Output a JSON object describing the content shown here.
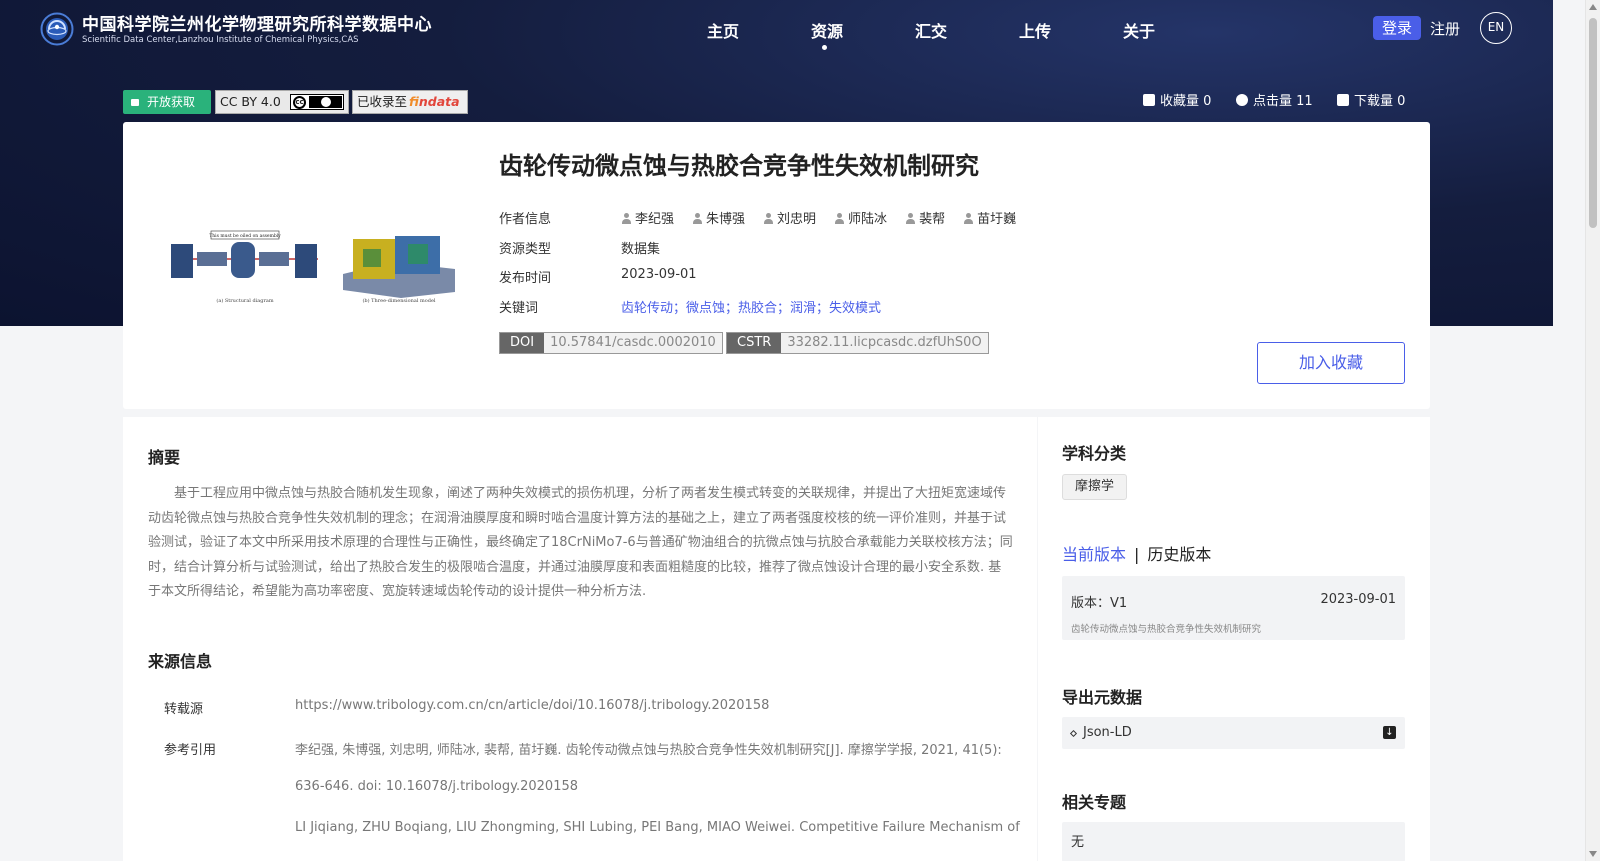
{
  "header": {
    "brand_cn": "中国科学院兰州化学物理研究所科学数据中心",
    "brand_en": "Scientific Data Center,Lanzhou Institute of Chemical Physics,CAS",
    "nav": [
      "主页",
      "资源",
      "汇交",
      "上传",
      "关于"
    ],
    "active_nav": "资源",
    "login": "登录",
    "register": "注册",
    "lang": "EN",
    "accent": "#4a5ee8"
  },
  "badges": {
    "open_access": "开放获取",
    "license": "CC BY 4.0",
    "indexed_prefix": "已收录至",
    "findata": {
      "f": "f",
      "i": "i",
      "rest": "ndata"
    }
  },
  "stats": {
    "favorites": "收藏量 0",
    "clicks": "点击量 11",
    "downloads": "下载量 0"
  },
  "record": {
    "title": "齿轮传动微点蚀与热胶合竞争性失效机制研究",
    "labels": {
      "authors": "作者信息",
      "type": "资源类型",
      "date": "发布时间",
      "keywords": "关键词"
    },
    "authors": [
      "李纪强",
      "朱博强",
      "刘忠明",
      "师陆冰",
      "裴帮",
      "苗圩巍"
    ],
    "type": "数据集",
    "date": "2023-09-01",
    "keywords": "齿轮传动；微点蚀；热胶合；润滑；失效模式",
    "doi_label": "DOI",
    "doi": "10.57841/casdc.0002010",
    "cstr_label": "CSTR",
    "cstr": "33282.11.licpcasdc.dzfUhS0O",
    "favorite_button": "加入收藏",
    "figure_captions": {
      "left_note": "This must be oiled on assembly",
      "left_caption": "(a) Structural diagram",
      "right_caption": "(b) Three-dimensional model"
    }
  },
  "abstract": {
    "title": "摘要",
    "text": "基于工程应用中微点蚀与热胶合随机发生现象，阐述了两种失效模式的损伤机理，分析了两者发生模式转变的关联规律，并提出了大扭矩宽速域传动齿轮微点蚀与热胶合竞争性失效机制的理念；在润滑油膜厚度和瞬时啮合温度计算方法的基础之上，建立了两者强度校核的统一评价准则，并基于试验测试，验证了本文中所采用技术原理的合理性与正确性，最终确定了18CrNiMo7-6与普通矿物油组合的抗微点蚀与抗胶合承载能力关联校核方法；同时，结合计算分析与试验测试，给出了热胶合发生的极限啮合温度，并通过油膜厚度和表面粗糙度的比较，推荐了微点蚀设计合理的最小安全系数. 基于本文所得结论，希望能为高功率密度、宽旋转速域齿轮传动的设计提供一种分析方法."
  },
  "source": {
    "title": "来源信息",
    "repost_label": "转载源",
    "repost_url": "https://www.tribology.com.cn/cn/article/doi/10.16078/j.tribology.2020158",
    "citation_label": "参考引用",
    "citation_cn_1": "李纪强, 朱博强, 刘忠明, 师陆冰, 裴帮, 苗圩巍. 齿轮传动微点蚀与热胶合竞争性失效机制研究[J]. 摩擦学学报, 2021, 41(5):",
    "citation_cn_2": "636-646. doi: 10.16078/j.tribology.2020158",
    "citation_en_1": "LI Jiqiang, ZHU Boqiang, LIU Zhongming, SHI Lubing, PEI Bang, MIAO Weiwei. Competitive Failure Mechanism of"
  },
  "sidebar": {
    "subject_title": "学科分类",
    "subject_tag": "摩擦学",
    "current_version": "当前版本",
    "separator": "|",
    "history_version": "历史版本",
    "version_label": "版本：V1",
    "version_date": "2023-09-01",
    "version_title": "齿轮传动微点蚀与热胶合竞争性失效机制研究",
    "export_title": "导出元数据",
    "export_format": "Json-LD",
    "topics_title": "相关专题",
    "topics_value": "无"
  }
}
